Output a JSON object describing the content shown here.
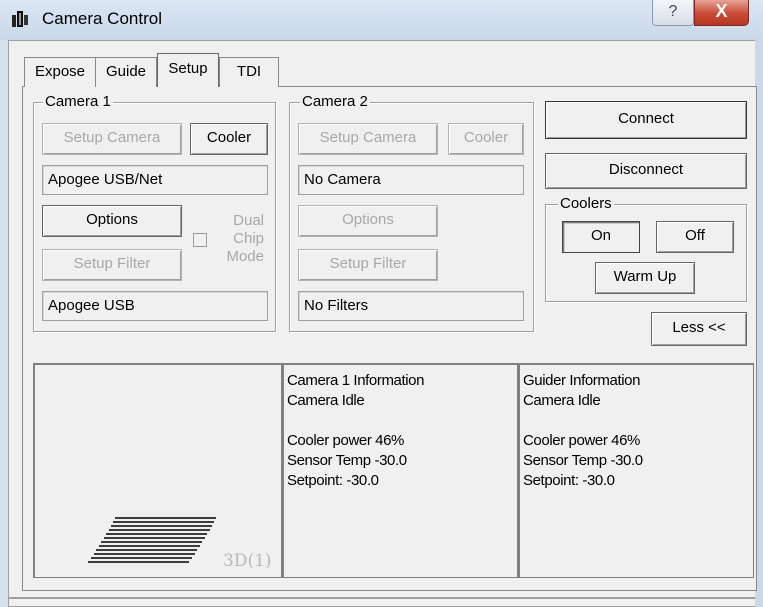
{
  "window": {
    "title": "Camera Control",
    "help_glyph": "?",
    "close_glyph": "X"
  },
  "tabs": [
    {
      "label": "Expose",
      "active": false
    },
    {
      "label": "Guide",
      "active": false
    },
    {
      "label": "Setup",
      "active": true
    },
    {
      "label": "TDI",
      "active": false
    }
  ],
  "camera1": {
    "group_label": "Camera 1",
    "setup_camera_label": "Setup Camera",
    "cooler_label": "Cooler",
    "camera_value": "Apogee USB/Net",
    "options_label": "Options",
    "dual_chip_label": [
      "Dual",
      "Chip",
      "Mode"
    ],
    "setup_filter_label": "Setup Filter",
    "filter_value": "Apogee USB"
  },
  "camera2": {
    "group_label": "Camera 2",
    "setup_camera_label": "Setup Camera",
    "cooler_label": "Cooler",
    "camera_value": "No Camera",
    "options_label": "Options",
    "setup_filter_label": "Setup Filter",
    "filter_value": "No Filters"
  },
  "connection": {
    "connect_label": "Connect",
    "disconnect_label": "Disconnect"
  },
  "coolers": {
    "group_label": "Coolers",
    "on_label": "On",
    "off_label": "Off",
    "warm_up_label": "Warm Up"
  },
  "less_label": "Less <<",
  "preview": {
    "badge": "3D(1)"
  },
  "camera1_info": {
    "title": "Camera 1 Information",
    "status": "Camera Idle",
    "cooler_power": "Cooler power 46%",
    "sensor_temp": "Sensor Temp -30.0",
    "setpoint": "Setpoint: -30.0"
  },
  "guider_info": {
    "title": "Guider Information",
    "status": "Camera Idle",
    "cooler_power": "Cooler power 46%",
    "sensor_temp": "Sensor Temp -30.0",
    "setpoint": "Setpoint: -30.0"
  },
  "colors": {
    "dialog_bg": "#f0f0f0",
    "close_button": "#c84a35",
    "disabled_text": "#a8a8a8"
  }
}
